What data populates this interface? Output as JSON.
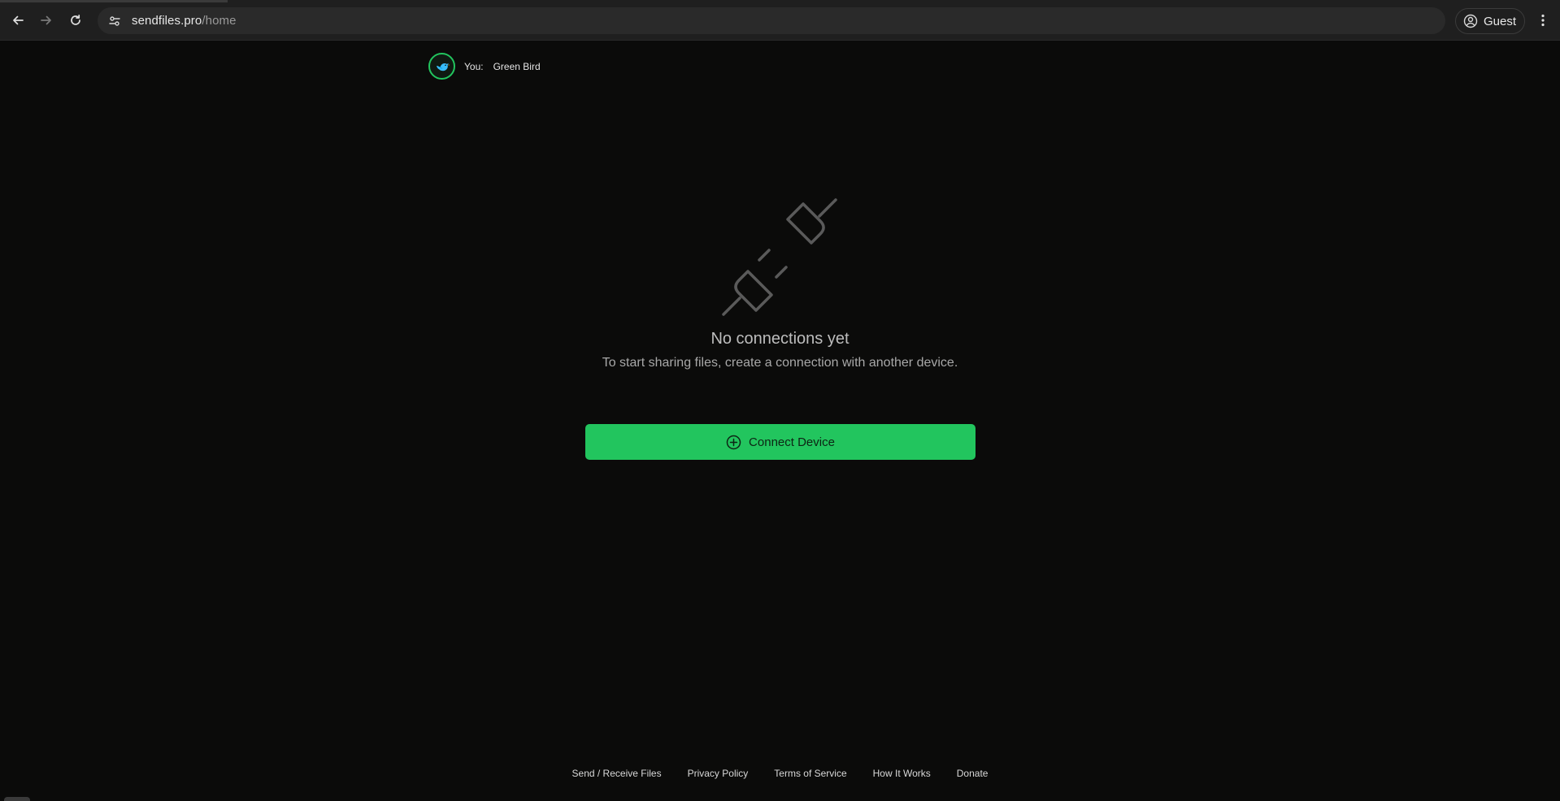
{
  "browser": {
    "url_host": "sendfiles.pro",
    "url_path": "/home",
    "profile_label": "Guest"
  },
  "user": {
    "you_label": "You:",
    "device_name": "Green Bird",
    "avatar_icon": "bird-icon"
  },
  "empty_state": {
    "illustration_icon": "unplugged-icon",
    "title": "No connections yet",
    "subtitle": "To start sharing files, create a connection with another device."
  },
  "actions": {
    "connect_label": "Connect Device",
    "connect_icon": "plus-circle-icon"
  },
  "footer": {
    "links": [
      "Send / Receive Files",
      "Privacy Policy",
      "Terms of Service",
      "How It Works",
      "Donate"
    ]
  },
  "colors": {
    "accent": "#22c55e",
    "background": "#0b0b0a"
  }
}
